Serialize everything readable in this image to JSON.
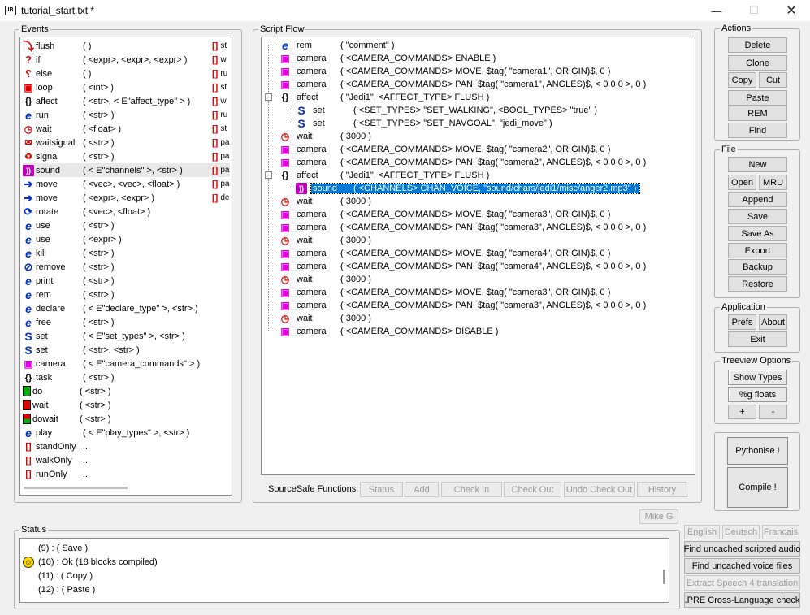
{
  "window": {
    "title": "tutorial_start.txt *"
  },
  "events": {
    "label": "Events",
    "items": [
      {
        "icon": "flush-icon",
        "name": "flush",
        "args": "(  )",
        "right": "st"
      },
      {
        "icon": "if-icon",
        "name": "if",
        "args": "( <expr>, <expr>, <expr> )",
        "right": "w"
      },
      {
        "icon": "else-icon",
        "name": "else",
        "args": "(  )",
        "right": "ru"
      },
      {
        "icon": "loop-icon",
        "name": "loop",
        "args": "( <int> )",
        "right": "st"
      },
      {
        "icon": "affect-icon",
        "name": "affect",
        "args": "( <str>, < E\"affect_type\" > )",
        "right": "w"
      },
      {
        "icon": "run-icon",
        "name": "run",
        "args": "( <str> )",
        "right": "ru"
      },
      {
        "icon": "wait-clock-icon",
        "name": "wait",
        "args": "( <float> )",
        "right": "st"
      },
      {
        "icon": "waitsignal-icon",
        "name": "waitsignal",
        "args": "( <str> )",
        "right": "pa"
      },
      {
        "icon": "signal-icon",
        "name": "signal",
        "args": "( <str> )",
        "right": "pa"
      },
      {
        "icon": "sound-icon",
        "name": "sound",
        "args": "( < E\"channels\" >, <str> )",
        "right": "pa"
      },
      {
        "icon": "move-arrow-icon",
        "name": "move",
        "args": "( <vec>, <vec>, <float> )",
        "right": "pa"
      },
      {
        "icon": "move-arrow-icon",
        "name": "move",
        "args": "( <expr>, <expr> )",
        "right": "de"
      },
      {
        "icon": "rotate-icon",
        "name": "rotate",
        "args": "( <vec>, <float> )",
        "right": ""
      },
      {
        "icon": "e-icon",
        "name": "use",
        "args": "( <str> )",
        "right": ""
      },
      {
        "icon": "e-icon",
        "name": "use",
        "args": "( <expr> )",
        "right": ""
      },
      {
        "icon": "e-icon",
        "name": "kill",
        "args": "( <str> )",
        "right": ""
      },
      {
        "icon": "remove-icon",
        "name": "remove",
        "args": "( <str> )",
        "right": ""
      },
      {
        "icon": "e-icon",
        "name": "print",
        "args": "( <str> )",
        "right": ""
      },
      {
        "icon": "e-icon",
        "name": "rem",
        "args": "( <str> )",
        "right": ""
      },
      {
        "icon": "e-icon",
        "name": "declare",
        "args": "( < E\"declare_type\" >, <str> )",
        "right": ""
      },
      {
        "icon": "e-icon",
        "name": "free",
        "args": "( <str> )",
        "right": ""
      },
      {
        "icon": "set-icon",
        "name": "set",
        "args": "( < E\"set_types\" >, <str> )",
        "right": ""
      },
      {
        "icon": "set-icon",
        "name": "set",
        "args": "( <str>, <str> )",
        "right": ""
      },
      {
        "icon": "camera-icon",
        "name": "camera",
        "args": "( < E\"camera_commands\" > )",
        "right": ""
      },
      {
        "icon": "task-icon",
        "name": "task",
        "args": "( <str> )",
        "right": ""
      },
      {
        "icon": "do-icon",
        "name": "do",
        "args": "( <str> )",
        "right": ""
      },
      {
        "icon": "wait-block-icon",
        "name": "wait",
        "args": "( <str> )",
        "right": ""
      },
      {
        "icon": "dowait-icon",
        "name": "dowait",
        "args": "( <str> )",
        "right": ""
      },
      {
        "icon": "e-icon",
        "name": "play",
        "args": "( < E\"play_types\" >, <str> )",
        "right": ""
      },
      {
        "icon": "bracket-icon",
        "name": "standOnly",
        "args": "...",
        "right": ""
      },
      {
        "icon": "bracket-icon",
        "name": "walkOnly",
        "args": "...",
        "right": ""
      },
      {
        "icon": "bracket-icon",
        "name": "runOnly",
        "args": "...",
        "right": ""
      }
    ]
  },
  "script_flow": {
    "label": "Script Flow",
    "rows": [
      {
        "depth": 0,
        "icon": "e-icon",
        "name": "rem",
        "args": "( \"comment\" )"
      },
      {
        "depth": 0,
        "icon": "camera-icon",
        "name": "camera",
        "args": "( <CAMERA_COMMANDS> ENABLE )"
      },
      {
        "depth": 0,
        "icon": "camera-icon",
        "name": "camera",
        "args": "( <CAMERA_COMMANDS> MOVE, $tag( \"camera1\", ORIGIN)$, 0 )"
      },
      {
        "depth": 0,
        "icon": "camera-icon",
        "name": "camera",
        "args": "( <CAMERA_COMMANDS> PAN, $tag( \"camera1\", ANGLES)$, < 0 0 0 >, 0 )"
      },
      {
        "depth": 0,
        "icon": "affect-icon",
        "name": "affect",
        "args": "( \"Jedi1\", <AFFECT_TYPE> FLUSH )",
        "expander": "-"
      },
      {
        "depth": 1,
        "icon": "set-icon",
        "name": "set",
        "args": "( <SET_TYPES> \"SET_WALKING\", <BOOL_TYPES> \"true\" )"
      },
      {
        "depth": 1,
        "icon": "set-icon",
        "name": "set",
        "args": "( <SET_TYPES> \"SET_NAVGOAL\", \"jedi_move\" )"
      },
      {
        "depth": 0,
        "icon": "wait-clock-icon",
        "name": "wait",
        "args": "( 3000 )"
      },
      {
        "depth": 0,
        "icon": "camera-icon",
        "name": "camera",
        "args": "( <CAMERA_COMMANDS> MOVE, $tag( \"camera2\", ORIGIN)$, 0 )"
      },
      {
        "depth": 0,
        "icon": "camera-icon",
        "name": "camera",
        "args": "( <CAMERA_COMMANDS> PAN, $tag( \"camera2\", ANGLES)$, < 0 0 0 >, 0 )"
      },
      {
        "depth": 0,
        "icon": "affect-icon",
        "name": "affect",
        "args": "( \"Jedi1\", <AFFECT_TYPE> FLUSH )",
        "expander": "-"
      },
      {
        "depth": 1,
        "icon": "sound-icon",
        "name": "sound",
        "args": "( <CHANNELS> CHAN_VOICE, \"sound/chars/jedi1/misc/anger2.mp3\" )",
        "selected": true
      },
      {
        "depth": 0,
        "icon": "wait-clock-icon",
        "name": "wait",
        "args": "( 3000 )"
      },
      {
        "depth": 0,
        "icon": "camera-icon",
        "name": "camera",
        "args": "( <CAMERA_COMMANDS> MOVE, $tag( \"camera3\", ORIGIN)$, 0 )"
      },
      {
        "depth": 0,
        "icon": "camera-icon",
        "name": "camera",
        "args": "( <CAMERA_COMMANDS> PAN, $tag( \"camera3\", ANGLES)$, < 0 0 0 >, 0 )"
      },
      {
        "depth": 0,
        "icon": "wait-clock-icon",
        "name": "wait",
        "args": "( 3000 )"
      },
      {
        "depth": 0,
        "icon": "camera-icon",
        "name": "camera",
        "args": "( <CAMERA_COMMANDS> MOVE, $tag( \"camera4\", ORIGIN)$, 0 )"
      },
      {
        "depth": 0,
        "icon": "camera-icon",
        "name": "camera",
        "args": "( <CAMERA_COMMANDS> PAN, $tag( \"camera4\", ANGLES)$, < 0 0 0 >, 0 )"
      },
      {
        "depth": 0,
        "icon": "wait-clock-icon",
        "name": "wait",
        "args": "( 3000 )"
      },
      {
        "depth": 0,
        "icon": "camera-icon",
        "name": "camera",
        "args": "( <CAMERA_COMMANDS> MOVE, $tag( \"camera3\", ORIGIN)$, 0 )"
      },
      {
        "depth": 0,
        "icon": "camera-icon",
        "name": "camera",
        "args": "( <CAMERA_COMMANDS> PAN, $tag( \"camera3\", ANGLES)$, < 0 0 0 >, 0 )"
      },
      {
        "depth": 0,
        "icon": "wait-clock-icon",
        "name": "wait",
        "args": "( 3000 )"
      },
      {
        "depth": 0,
        "icon": "camera-icon",
        "name": "camera",
        "args": "( <CAMERA_COMMANDS> DISABLE )"
      }
    ]
  },
  "sourcesafe": {
    "label": "SourceSafe Functions:",
    "buttons": [
      "Status",
      "Add",
      "Check In",
      "Check Out",
      "Undo Check Out",
      "History"
    ]
  },
  "actions": {
    "label": "Actions",
    "delete": "Delete",
    "clone": "Clone",
    "copy": "Copy",
    "cut": "Cut",
    "paste": "Paste",
    "rem": "REM",
    "find": "Find"
  },
  "file": {
    "label": "File",
    "new": "New",
    "open": "Open",
    "mru": "MRU",
    "append": "Append",
    "save": "Save",
    "save_as": "Save As",
    "export": "Export",
    "backup": "Backup",
    "restore": "Restore"
  },
  "application": {
    "label": "Application",
    "prefs": "Prefs",
    "about": "About",
    "exit": "Exit"
  },
  "treeview": {
    "label": "Treeview Options",
    "show_types": "Show Types",
    "g_floats": "%g floats",
    "plus": "+",
    "minus": "-"
  },
  "pythonise": "Pythonise !",
  "compile": "Compile !",
  "user": "Mike G",
  "status": {
    "label": "Status",
    "lines": [
      {
        "text": "(9) : ( Save )",
        "smiley": false
      },
      {
        "text": "(10) : Ok   (18 blocks compiled)",
        "smiley": true
      },
      {
        "text": "(11) : ( Copy )",
        "smiley": false
      },
      {
        "text": "(12) : ( Paste )",
        "smiley": false
      }
    ]
  },
  "languages": [
    "English",
    "Deutsch",
    "Francais"
  ],
  "tools": [
    "Find uncached scripted audio",
    "Find uncached voice files",
    "Extract Speech 4 translation",
    ".PRE Cross-Language check"
  ]
}
